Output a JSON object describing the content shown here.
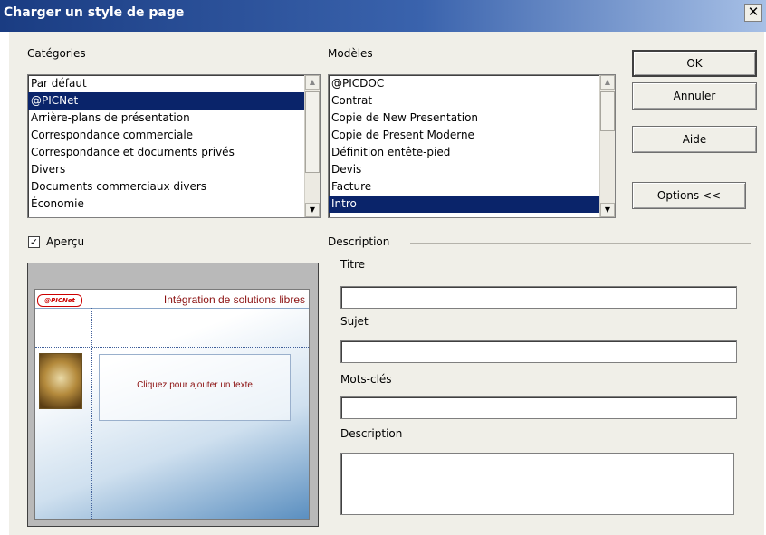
{
  "window": {
    "title": "Charger un style de page"
  },
  "categories": {
    "label": "Catégories",
    "items": [
      "Par défaut",
      "@PICNet",
      "Arrière-plans de présentation",
      "Correspondance commerciale",
      "Correspondance et documents privés",
      "Divers",
      "Documents commerciaux divers",
      "Économie"
    ],
    "selected_index": 1
  },
  "templates": {
    "label": "Modèles",
    "items": [
      "@PICDOC",
      "Contrat",
      "Copie de New Presentation",
      "Copie de Present Moderne",
      "Définition entête-pied",
      "Devis",
      "Facture",
      "Intro"
    ],
    "selected_index": 7
  },
  "buttons": {
    "ok": "OK",
    "cancel": "Annuler",
    "help": "Aide",
    "options": "Options <<"
  },
  "preview": {
    "checkbox_label": "Aperçu",
    "checked": true,
    "slide_brand": "@PICNet",
    "slide_title": "Intégration de solutions libres",
    "slide_body": "Cliquez pour ajouter un texte"
  },
  "description": {
    "group_label": "Description",
    "title_label": "Titre",
    "title_value": "",
    "subject_label": "Sujet",
    "subject_value": "",
    "keywords_label": "Mots-clés",
    "keywords_value": "",
    "description_label": "Description",
    "description_value": ""
  },
  "colors": {
    "selection": "#0a246a",
    "dialog_bg": "#f0efe8",
    "titlebar": "#1a3c82"
  }
}
